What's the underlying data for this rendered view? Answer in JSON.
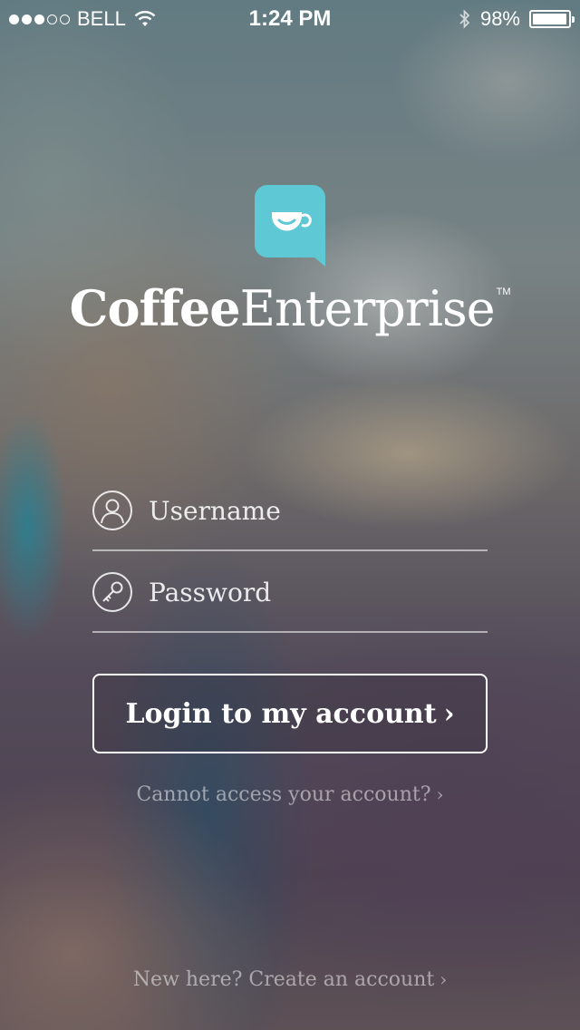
{
  "status_bar": {
    "carrier": "BELL",
    "time": "1:24 PM",
    "battery": "98%",
    "signal_filled": 3,
    "signal_total": 5,
    "icons": [
      "signal-dots-icon",
      "wifi-icon",
      "bluetooth-icon",
      "battery-icon"
    ]
  },
  "brand": {
    "name_bold": "Coffee",
    "name_light": "Enterprise",
    "trademark": "TM",
    "logo_color": "#5ec8d4"
  },
  "login_form": {
    "username_placeholder": "Username",
    "password_placeholder": "Password",
    "login_label": "Login to my account",
    "chevron": "›"
  },
  "links": {
    "forgot": "Cannot access your account?",
    "signup": "New here? Create an account",
    "chevron": "›"
  }
}
